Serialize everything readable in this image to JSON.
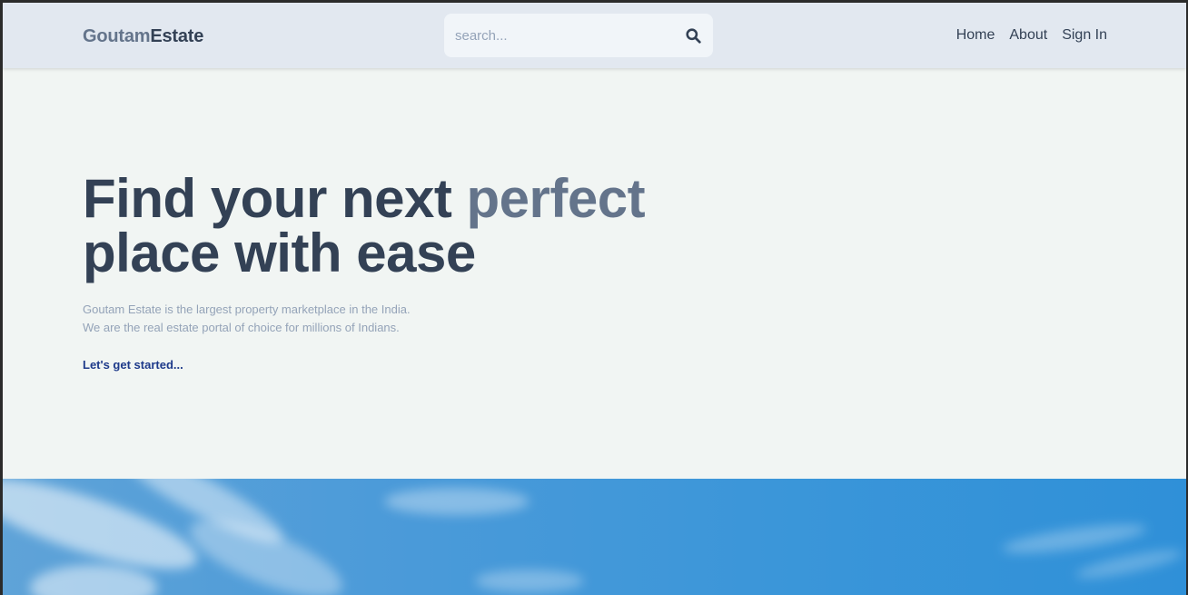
{
  "brand": {
    "part1": "Goutam",
    "part2": "Estate"
  },
  "search": {
    "placeholder": "search...",
    "icon": "search-icon"
  },
  "nav": {
    "home": "Home",
    "about": "About",
    "signin": "Sign In"
  },
  "hero": {
    "line1_a": "Find your next ",
    "line1_b": "perfect",
    "line2": "place with ease",
    "desc1": "Goutam Estate is the largest property marketplace in the India.",
    "desc2": "We are the real estate portal of choice for millions of Indians.",
    "cta": "Let's get started..."
  },
  "colors": {
    "header_bg": "#e2e8f0",
    "page_bg": "#f1f5f3",
    "text_dark": "#334155",
    "text_muted": "#64748b",
    "cta": "#1e3a8a"
  }
}
